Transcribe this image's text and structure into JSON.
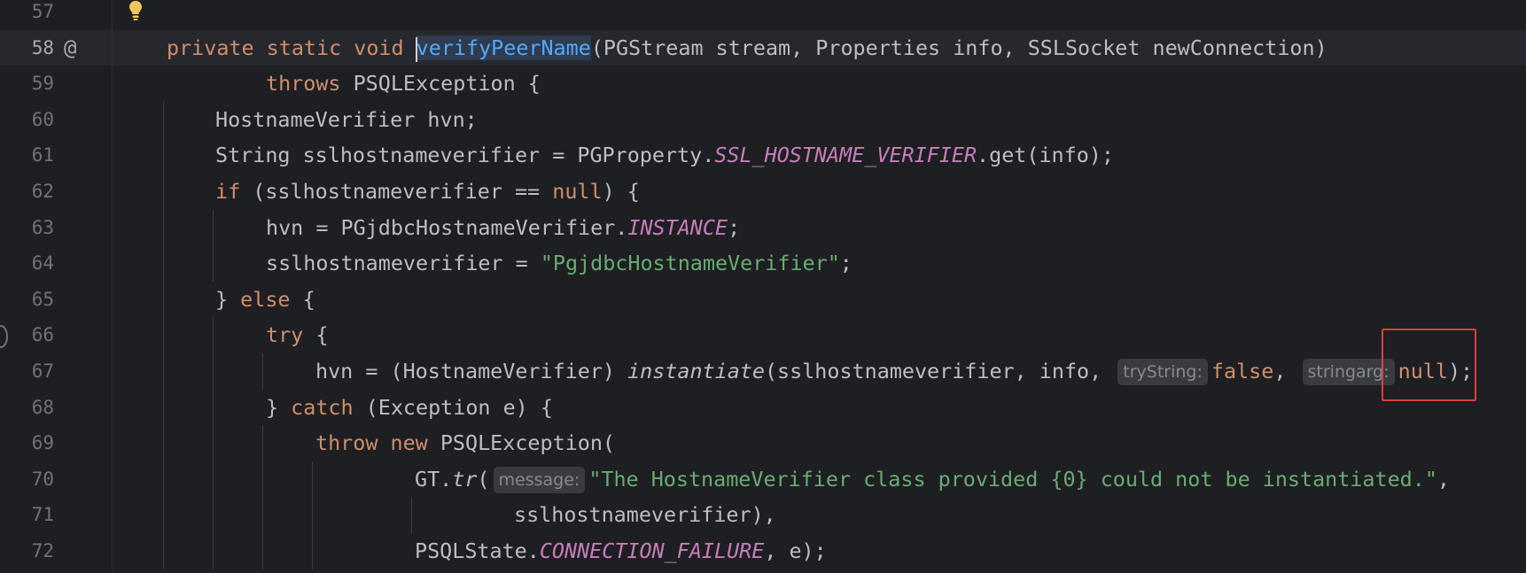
{
  "editor": {
    "lines": [
      {
        "num": "57",
        "tokens": []
      },
      {
        "num": "58",
        "tokens": [
          {
            "t": "private static void ",
            "c": "kw"
          },
          {
            "t": "verifyPeerName",
            "c": "fn"
          },
          {
            "t": "(PGStream stream, Properties info, SSLSocket newConnection)",
            "c": ""
          }
        ]
      },
      {
        "num": "59",
        "tokens": [
          {
            "t": "throws ",
            "c": "kw"
          },
          {
            "t": "PSQLException {",
            "c": ""
          }
        ]
      },
      {
        "num": "60",
        "tokens": [
          {
            "t": "HostnameVerifier hvn;",
            "c": ""
          }
        ]
      },
      {
        "num": "61",
        "tokens": [
          {
            "t": "String sslhostnameverifier = PGProperty.",
            "c": ""
          },
          {
            "t": "SSL_HOSTNAME_VERIFIER",
            "c": "st"
          },
          {
            "t": ".get(info);",
            "c": ""
          }
        ]
      },
      {
        "num": "62",
        "tokens": [
          {
            "t": "if ",
            "c": "kw"
          },
          {
            "t": "(sslhostnameverifier == ",
            "c": ""
          },
          {
            "t": "null",
            "c": "kw"
          },
          {
            "t": ") {",
            "c": ""
          }
        ]
      },
      {
        "num": "63",
        "tokens": [
          {
            "t": "hvn = PGjdbcHostnameVerifier.",
            "c": ""
          },
          {
            "t": "INSTANCE",
            "c": "st"
          },
          {
            "t": ";",
            "c": ""
          }
        ]
      },
      {
        "num": "64",
        "tokens": [
          {
            "t": "sslhostnameverifier = ",
            "c": ""
          },
          {
            "t": "\"PgjdbcHostnameVerifier\"",
            "c": "str"
          },
          {
            "t": ";",
            "c": ""
          }
        ]
      },
      {
        "num": "65",
        "tokens": [
          {
            "t": "} ",
            "c": ""
          },
          {
            "t": "else ",
            "c": "kw"
          },
          {
            "t": "{",
            "c": ""
          }
        ]
      },
      {
        "num": "66",
        "tokens": [
          {
            "t": "try ",
            "c": "kw"
          },
          {
            "t": "{",
            "c": ""
          }
        ]
      },
      {
        "num": "67",
        "tokens": [
          {
            "t": "hvn = (HostnameVerifier) ",
            "c": ""
          },
          {
            "t": "instantiate",
            "c": "it"
          },
          {
            "t": "(sslhostnameverifier, info, ",
            "c": ""
          },
          {
            "hint": "tryString:"
          },
          {
            "t": "false",
            "c": "kw"
          },
          {
            "t": ", ",
            "c": ""
          },
          {
            "hint": "stringarg:"
          },
          {
            "t": "null",
            "c": "kw"
          },
          {
            "t": ");",
            "c": ""
          }
        ]
      },
      {
        "num": "68",
        "tokens": [
          {
            "t": "} ",
            "c": ""
          },
          {
            "t": "catch ",
            "c": "kw"
          },
          {
            "t": "(Exception e) {",
            "c": ""
          }
        ]
      },
      {
        "num": "69",
        "tokens": [
          {
            "t": "throw new ",
            "c": "kw"
          },
          {
            "t": "PSQLException(",
            "c": ""
          }
        ]
      },
      {
        "num": "70",
        "tokens": [
          {
            "t": "GT.",
            "c": ""
          },
          {
            "t": "tr",
            "c": "it"
          },
          {
            "t": "(",
            "c": ""
          },
          {
            "hint": "message:"
          },
          {
            "t": "\"The HostnameVerifier class provided {0} could not be instantiated.\"",
            "c": "str"
          },
          {
            "t": ",",
            "c": ""
          }
        ]
      },
      {
        "num": "71",
        "tokens": [
          {
            "t": "sslhostnameverifier),",
            "c": ""
          }
        ]
      },
      {
        "num": "72",
        "tokens": [
          {
            "t": "PSQLState.",
            "c": ""
          },
          {
            "t": "CONNECTION_FAILURE",
            "c": "st"
          },
          {
            "t": ", e);",
            "c": ""
          }
        ]
      }
    ],
    "current_line": "58",
    "override_marker": "@",
    "lightbulb_icon": "lightbulb-icon"
  },
  "colors": {
    "background": "#1e1f22",
    "keyword": "#cf8e6d",
    "function": "#56a8f5",
    "static_field": "#c77dbb",
    "string": "#6aab73",
    "highlight_box": "#d9413e"
  }
}
